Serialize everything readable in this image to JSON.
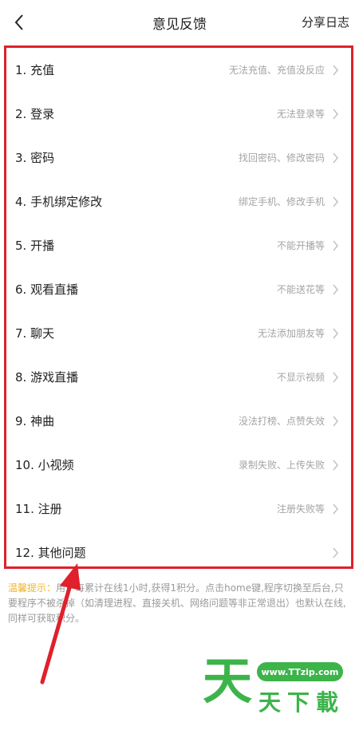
{
  "header": {
    "title": "意见反馈",
    "share_log": "分享日志",
    "back_icon": "chevron-left-icon"
  },
  "feedback_items": [
    {
      "label": "1. 充值",
      "hint": "无法充值、充值没反应"
    },
    {
      "label": "2. 登录",
      "hint": "无法登录等"
    },
    {
      "label": "3. 密码",
      "hint": "找回密码、修改密码"
    },
    {
      "label": "4. 手机绑定修改",
      "hint": "绑定手机、修改手机"
    },
    {
      "label": "5. 开播",
      "hint": "不能开播等"
    },
    {
      "label": "6. 观看直播",
      "hint": "不能送花等"
    },
    {
      "label": "7. 聊天",
      "hint": "无法添加朋友等"
    },
    {
      "label": "8. 游戏直播",
      "hint": "不显示视频"
    },
    {
      "label": "9. 神曲",
      "hint": "没法打榜、点赞失效"
    },
    {
      "label": "10. 小视频",
      "hint": "录制失败、上传失败"
    },
    {
      "label": "11. 注册",
      "hint": "注册失败等"
    },
    {
      "label": "12. 其他问题",
      "hint": ""
    }
  ],
  "tip": {
    "label": "温馨提示：",
    "text": "用户每累计在线1小时,获得1积分。点击home键,程序切换至后台,只要程序不被杀掉（如清理进程、直接关机、网络问题等非正常退出）也默认在线,同样可获取积分。"
  },
  "watermark": {
    "big_char": "天",
    "url": "www.TTzip.com",
    "chars": [
      "天",
      "下",
      "載"
    ]
  },
  "colors": {
    "highlight_border": "#e0202b",
    "tip_label": "#f0b429",
    "watermark_green": "#3cb44a"
  }
}
